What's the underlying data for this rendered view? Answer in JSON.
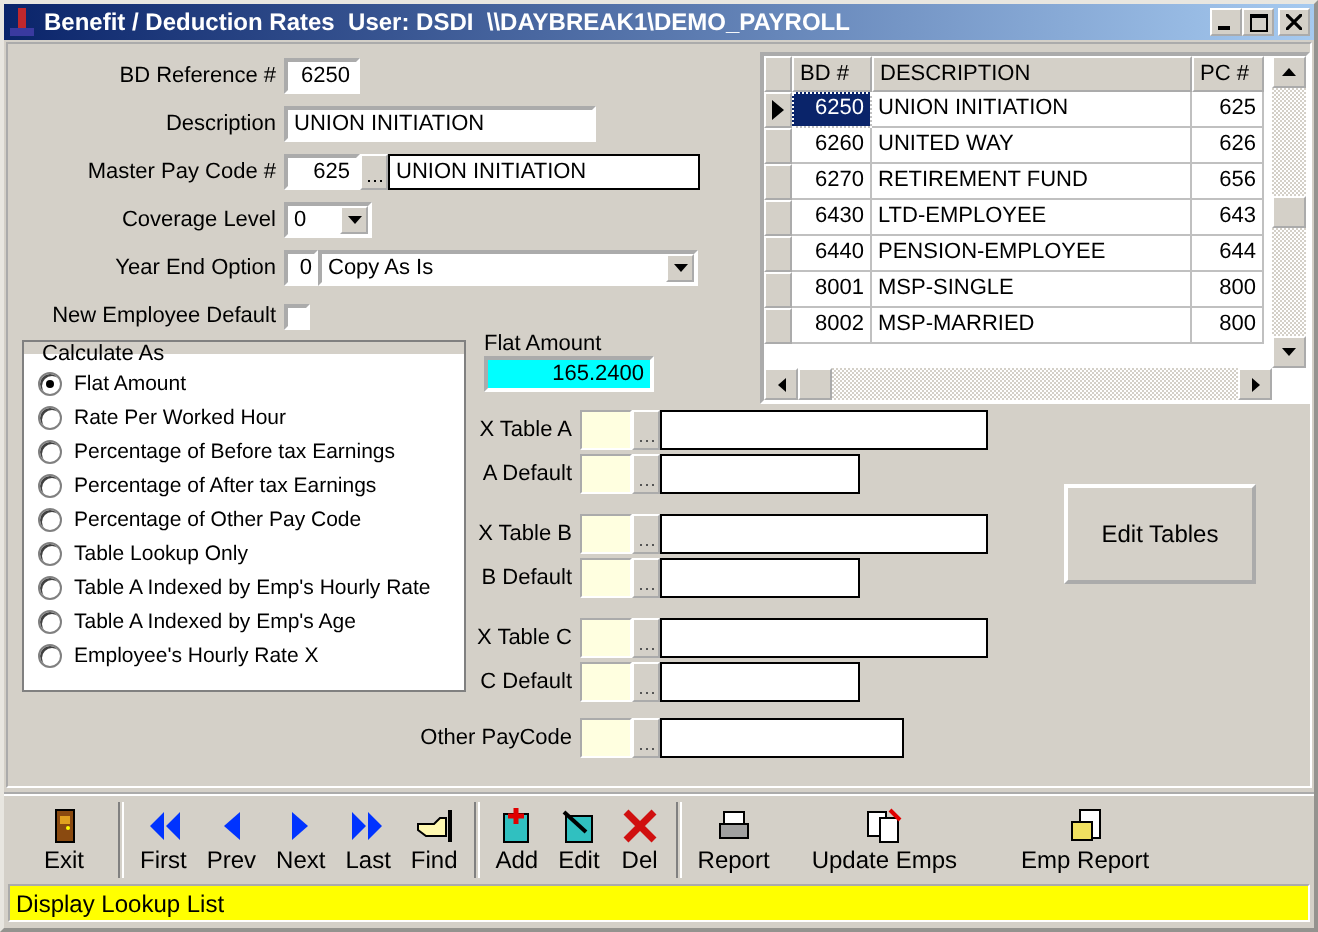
{
  "window": {
    "title": "Benefit / Deduction Rates  User: DSDI  \\\\DAYBREAK1\\DEMO_PAYROLL"
  },
  "form": {
    "bd_reference": {
      "label": "BD Reference #",
      "value": "6250"
    },
    "description": {
      "label": "Description",
      "value": "UNION INITIATION"
    },
    "master_pay_code": {
      "label": "Master Pay Code #",
      "code": "625",
      "description": "UNION INITIATION"
    },
    "coverage_level": {
      "label": "Coverage Level",
      "value": "0"
    },
    "year_end_option": {
      "label": "Year End Option",
      "code": "0",
      "value": "Copy As Is"
    },
    "new_employee_default": {
      "label": "New Employee Default",
      "checked": false
    }
  },
  "flat_amount": {
    "label": "Flat Amount",
    "value": "165.2400"
  },
  "calculate_as": {
    "title": "Calculate As",
    "options": [
      {
        "label": "Flat Amount",
        "selected": true
      },
      {
        "label": "Rate Per Worked Hour",
        "selected": false
      },
      {
        "label": "Percentage of Before tax Earnings",
        "selected": false
      },
      {
        "label": "Percentage of After tax Earnings",
        "selected": false
      },
      {
        "label": "Percentage of Other Pay Code",
        "selected": false
      },
      {
        "label": "Table Lookup Only",
        "selected": false
      },
      {
        "label": "Table A Indexed by Emp's Hourly Rate",
        "selected": false
      },
      {
        "label": "Table A Indexed by Emp's Age",
        "selected": false
      },
      {
        "label": "Employee's Hourly Rate X",
        "selected": false
      }
    ]
  },
  "lookups": [
    {
      "label": "X Table A",
      "kind": "table"
    },
    {
      "label": "A Default",
      "kind": "default"
    },
    {
      "label": "X Table B",
      "kind": "table"
    },
    {
      "label": "B Default",
      "kind": "default"
    },
    {
      "label": "X Table C",
      "kind": "table"
    },
    {
      "label": "C Default",
      "kind": "default"
    },
    {
      "label": "Other PayCode",
      "kind": "other"
    }
  ],
  "table": {
    "columns": [
      "BD #",
      "DESCRIPTION",
      "PC #"
    ],
    "rows": [
      {
        "bd": "6250",
        "description": "UNION INITIATION",
        "pc": "625",
        "selected": true
      },
      {
        "bd": "6260",
        "description": "UNITED WAY",
        "pc": "626",
        "selected": false
      },
      {
        "bd": "6270",
        "description": "RETIREMENT FUND",
        "pc": "656",
        "selected": false
      },
      {
        "bd": "6430",
        "description": "LTD-EMPLOYEE",
        "pc": "643",
        "selected": false
      },
      {
        "bd": "6440",
        "description": "PENSION-EMPLOYEE",
        "pc": "644",
        "selected": false
      },
      {
        "bd": "8001",
        "description": "MSP-SINGLE",
        "pc": "800",
        "selected": false
      },
      {
        "bd": "8002",
        "description": "MSP-MARRIED",
        "pc": "800",
        "selected": false
      }
    ]
  },
  "edit_tables_button": "Edit Tables",
  "toolbar": [
    {
      "label": "Exit",
      "kind": "exit",
      "separator_after": true
    },
    {
      "label": "First",
      "kind": "first",
      "separator_after": false
    },
    {
      "label": "Prev",
      "kind": "prev",
      "separator_after": false
    },
    {
      "label": "Next",
      "kind": "next",
      "separator_after": false
    },
    {
      "label": "Last",
      "kind": "last",
      "separator_after": false
    },
    {
      "label": "Find",
      "kind": "find",
      "separator_after": true
    },
    {
      "label": "Add",
      "kind": "add",
      "separator_after": false
    },
    {
      "label": "Edit",
      "kind": "edit",
      "separator_after": false
    },
    {
      "label": "Del",
      "kind": "delete",
      "separator_after": true
    },
    {
      "label": "Report",
      "kind": "report",
      "separator_after": false
    },
    {
      "label": "Update Emps",
      "kind": "update",
      "separator_after": false
    },
    {
      "label": "Emp Report",
      "kind": "empreport",
      "separator_after": false
    }
  ],
  "status_bar": "Display Lookup List"
}
